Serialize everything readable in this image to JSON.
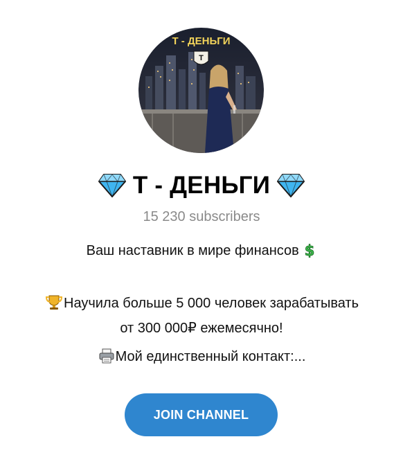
{
  "channel": {
    "title": "Т - ДЕНЬГИ",
    "avatar_caption": "Т - ДЕНЬГИ",
    "avatar_badge_letter": "Т",
    "subscribers": "15 230 subscribers",
    "description": {
      "line1": "Ваш наставник в мире финансов",
      "line2": "Научила больше 5 000 человек зарабатывать",
      "line3": "от 300 000₽ ежемесячно!",
      "line4": "Мой единственный контакт:..."
    },
    "join_label": "JOIN CHANNEL"
  },
  "icons": {
    "title_left": "gem-stone-icon",
    "title_right": "gem-stone-icon",
    "line1_end": "dollar-sign-icon",
    "line2_start": "trophy-icon",
    "line4_start": "printer-icon"
  },
  "colors": {
    "accent": "#2f86cf",
    "subscribers_text": "#8a8a8a",
    "gem": "#3fb5f0",
    "dollar": "#3bb54a",
    "trophy": "#f0b429"
  }
}
